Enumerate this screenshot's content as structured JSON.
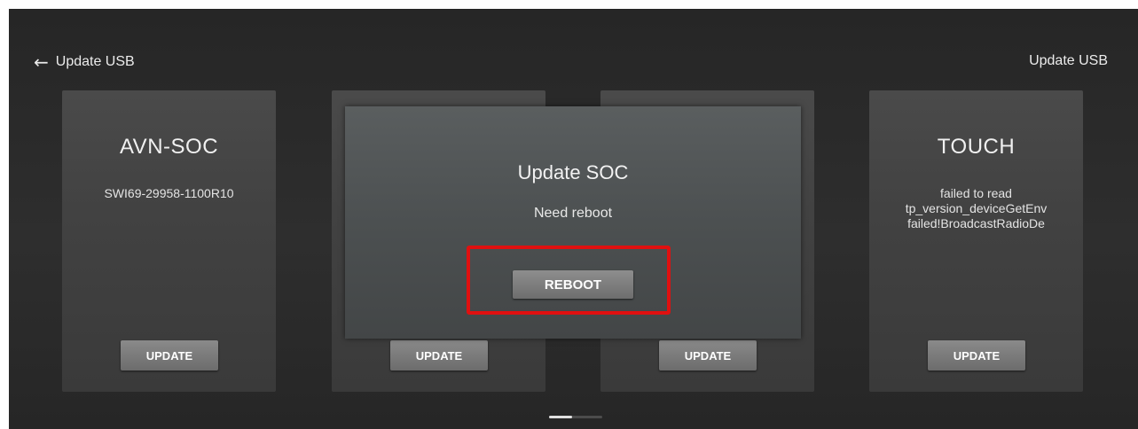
{
  "header": {
    "back_icon": "left-arrow-icon",
    "back_label": "Update USB",
    "title_right": "Update USB"
  },
  "cards": [
    {
      "title": "AVN-SOC",
      "version": "SWI69-29958-1100R10",
      "button": "UPDATE"
    },
    {
      "title": "",
      "version": "",
      "button": "UPDATE"
    },
    {
      "title": "",
      "version": "",
      "button": "UPDATE"
    },
    {
      "title": "TOUCH",
      "version": "failed to read\ntp_version_deviceGetEnv\nfailed!BroadcastRadioDe",
      "button": "UPDATE"
    }
  ],
  "dialog": {
    "title": "Update SOC",
    "message": "Need reboot",
    "button": "REBOOT",
    "highlight_color": "#e01010"
  },
  "pager": {
    "pages": 2,
    "active": 1
  }
}
